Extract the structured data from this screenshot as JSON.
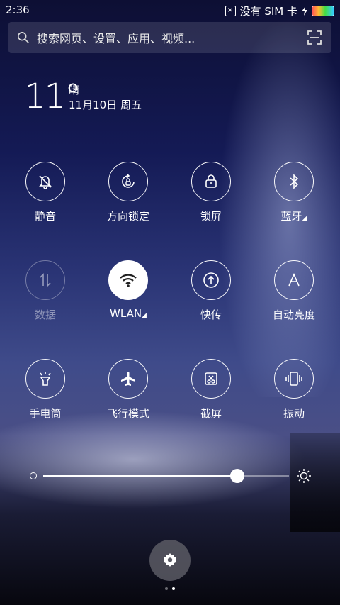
{
  "status": {
    "time": "2:36",
    "sim_text": "没有 SIM 卡"
  },
  "search": {
    "placeholder": "搜索网页、设置、应用、视频..."
  },
  "weather": {
    "temperature": "11°",
    "condition": "晴",
    "date": "11月10日 周五"
  },
  "toggles": [
    {
      "label": "静音",
      "icon": "bell-off-icon",
      "state": "off"
    },
    {
      "label": "方向锁定",
      "icon": "rotation-lock-icon",
      "state": "off"
    },
    {
      "label": "锁屏",
      "icon": "lock-icon",
      "state": "off"
    },
    {
      "label": "蓝牙",
      "icon": "bluetooth-icon",
      "state": "off",
      "has_arrow": true
    },
    {
      "label": "数据",
      "icon": "data-arrows-icon",
      "state": "disabled"
    },
    {
      "label": "WLAN",
      "icon": "wifi-icon",
      "state": "on",
      "has_arrow": true
    },
    {
      "label": "快传",
      "icon": "share-upload-icon",
      "state": "off"
    },
    {
      "label": "自动亮度",
      "icon": "auto-brightness-icon",
      "state": "off"
    },
    {
      "label": "手电筒",
      "icon": "flashlight-icon",
      "state": "off"
    },
    {
      "label": "飞行模式",
      "icon": "airplane-icon",
      "state": "off"
    },
    {
      "label": "截屏",
      "icon": "screenshot-icon",
      "state": "off"
    },
    {
      "label": "振动",
      "icon": "vibrate-icon",
      "state": "off"
    }
  ],
  "brightness": {
    "value": 0.79
  },
  "pager": {
    "current": 2,
    "total": 2
  }
}
